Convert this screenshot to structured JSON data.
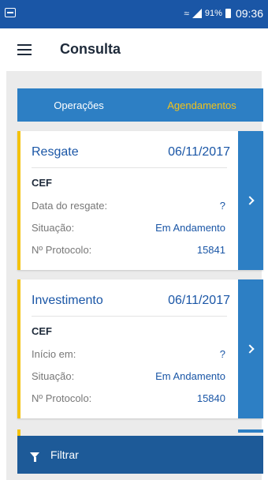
{
  "status_bar": {
    "battery": "91%",
    "time": "09:36"
  },
  "app_bar": {
    "title": "Consulta"
  },
  "tabs": [
    {
      "label": "Operações",
      "active": false
    },
    {
      "label": "Agendamentos",
      "active": true
    }
  ],
  "cards": [
    {
      "type": "Resgate",
      "date": "06/11/2017",
      "bank": "CEF",
      "rows": [
        {
          "label": "Data do resgate:",
          "value": "?"
        },
        {
          "label": "Situação:",
          "value": "Em Andamento"
        },
        {
          "label": "Nº Protocolo:",
          "value": "15841"
        }
      ]
    },
    {
      "type": "Investimento",
      "date": "06/11/2017",
      "bank": "CEF",
      "rows": [
        {
          "label": "Início em:",
          "value": "?"
        },
        {
          "label": "Situação:",
          "value": "Em Andamento"
        },
        {
          "label": "Nº Protocolo:",
          "value": "15840"
        }
      ]
    }
  ],
  "filter": {
    "label": "Filtrar"
  },
  "colors": {
    "primary": "#2d7fc4",
    "dark_blue": "#1d5a98",
    "accent": "#f4c20d",
    "text_blue": "#1a56a6"
  }
}
